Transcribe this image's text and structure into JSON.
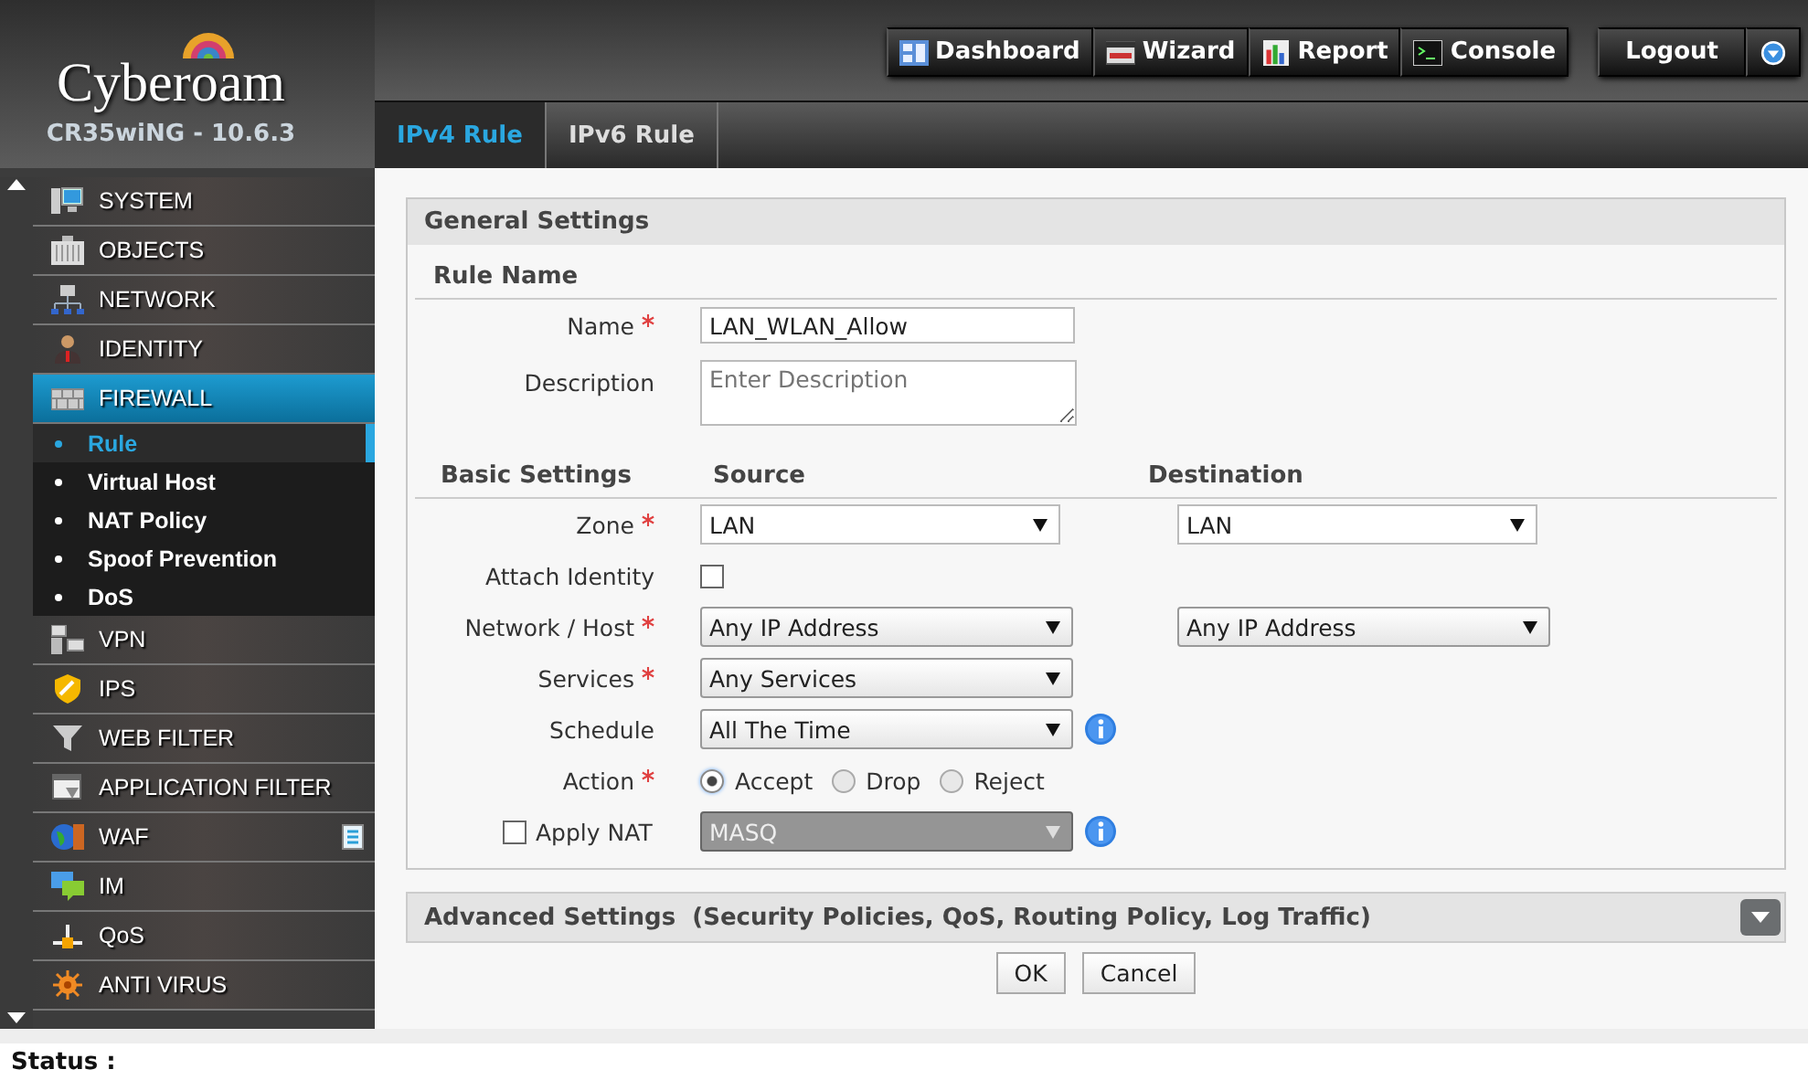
{
  "header": {
    "brand": "Cyberoam",
    "model": "CR35wiNG - 10.6.3",
    "toolbar": [
      {
        "label": "Dashboard",
        "kind": "dashboard"
      },
      {
        "label": "Wizard",
        "kind": "wizard"
      },
      {
        "label": "Report",
        "kind": "report"
      },
      {
        "label": "Console",
        "kind": "console"
      }
    ],
    "logout": "Logout"
  },
  "tabs": [
    {
      "label": "IPv4 Rule",
      "selected": true
    },
    {
      "label": "IPv6 Rule",
      "selected": false
    }
  ],
  "sidebar": {
    "items": [
      {
        "label": "SYSTEM",
        "kind": "system",
        "selected": false
      },
      {
        "label": "OBJECTS",
        "kind": "objects",
        "selected": false
      },
      {
        "label": "NETWORK",
        "kind": "network",
        "selected": false
      },
      {
        "label": "IDENTITY",
        "kind": "identity",
        "selected": false
      },
      {
        "label": "FIREWALL",
        "kind": "firewall",
        "selected": true,
        "children": [
          {
            "label": "Rule",
            "selected": true
          },
          {
            "label": "Virtual Host",
            "selected": false
          },
          {
            "label": "NAT Policy",
            "selected": false
          },
          {
            "label": "Spoof Prevention",
            "selected": false
          },
          {
            "label": "DoS",
            "selected": false
          }
        ]
      },
      {
        "label": "VPN",
        "kind": "vpn",
        "selected": false
      },
      {
        "label": "IPS",
        "kind": "ips",
        "selected": false
      },
      {
        "label": "WEB FILTER",
        "kind": "webfilter",
        "selected": false
      },
      {
        "label": "APPLICATION FILTER",
        "kind": "appfilter",
        "selected": false
      },
      {
        "label": "WAF",
        "kind": "waf",
        "selected": false,
        "badge": true
      },
      {
        "label": "IM",
        "kind": "im",
        "selected": false
      },
      {
        "label": "QoS",
        "kind": "qos",
        "selected": false
      },
      {
        "label": "ANTI VIRUS",
        "kind": "antivirus",
        "selected": false
      }
    ]
  },
  "form": {
    "title": "General Settings",
    "rule_name_heading": "Rule Name",
    "name": {
      "label": "Name",
      "required": true,
      "value": "LAN_WLAN_Allow"
    },
    "description": {
      "label": "Description",
      "placeholder": "Enter Description"
    },
    "basic_heading": "Basic Settings",
    "source_heading": "Source",
    "destination_heading": "Destination",
    "rows": [
      {
        "kind": "select",
        "label": "Zone",
        "required": true,
        "source": "LAN",
        "destination": "LAN",
        "info": false,
        "raised": false
      },
      {
        "kind": "checkbox",
        "label": "Attach Identity",
        "required": false,
        "checked": false
      },
      {
        "kind": "select",
        "label": "Network / Host",
        "required": true,
        "source": "Any IP Address",
        "destination": "Any IP Address",
        "info": false,
        "raised": true
      },
      {
        "kind": "select",
        "label": "Services",
        "required": true,
        "source": "Any Services",
        "info": false,
        "raised": true
      },
      {
        "kind": "select",
        "label": "Schedule",
        "required": false,
        "source": "All The Time",
        "info": true,
        "raised": true
      },
      {
        "kind": "radio",
        "label": "Action",
        "required": true,
        "options": [
          {
            "label": "Accept",
            "selected": true
          },
          {
            "label": "Drop",
            "selected": false
          },
          {
            "label": "Reject",
            "selected": false
          }
        ]
      },
      {
        "kind": "nat",
        "label": "Apply NAT",
        "checked": false,
        "value": "MASQ",
        "disabled": true,
        "info": true
      }
    ]
  },
  "advanced": {
    "title": "Advanced Settings",
    "detail": "(Security Policies, QoS, Routing Policy, Log Traffic)",
    "expanded": false
  },
  "buttons": [
    "OK",
    "Cancel"
  ],
  "status_bar": {
    "label": "Status :"
  }
}
